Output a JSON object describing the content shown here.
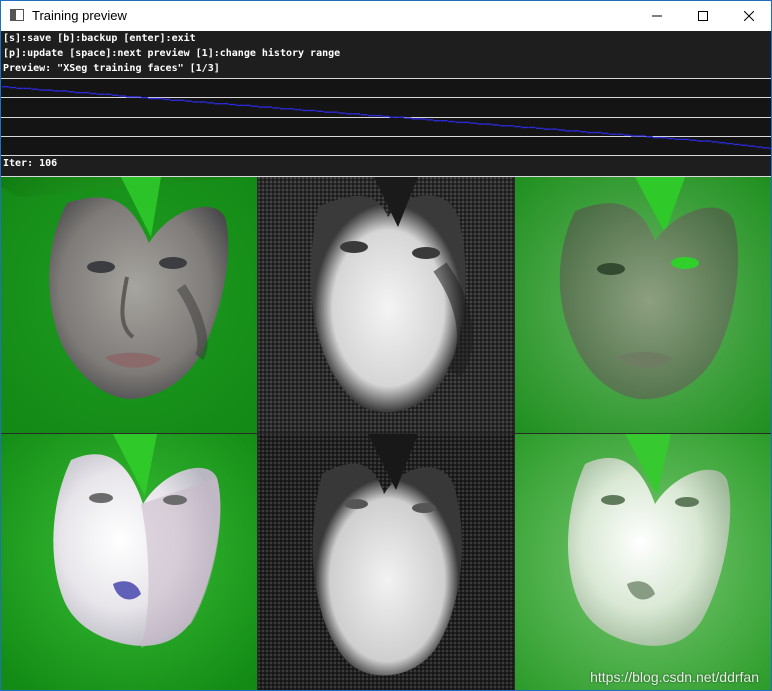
{
  "window": {
    "title": "Training preview",
    "app_icon": "window-app-icon",
    "controls": {
      "minimize_icon": "minimize-icon",
      "maximize_icon": "maximize-icon",
      "close_icon": "close-icon"
    }
  },
  "help": {
    "line1": "[s]:save [b]:backup [enter]:exit",
    "line2": "[p]:update [space]:next preview [1]:change history range",
    "line3": "Preview: \"XSeg training faces\" [1/3]"
  },
  "loss_history": {
    "color": "#2a2ad8",
    "values": [
      0.92,
      0.91,
      0.9,
      0.9,
      0.89,
      0.88,
      0.88,
      0.87,
      0.87,
      0.86,
      0.85,
      0.85,
      0.84,
      0.83,
      0.83,
      0.82,
      0.81,
      0.8,
      0.8,
      0.79,
      0.78,
      0.78,
      0.77,
      0.76,
      0.76,
      0.75,
      0.74,
      0.74,
      0.73,
      0.72,
      0.72,
      0.71,
      0.7,
      0.7,
      0.69,
      0.68,
      0.68,
      0.67,
      0.66,
      0.66,
      0.65,
      0.64,
      0.64,
      0.63,
      0.62,
      0.62,
      0.61,
      0.6,
      0.6,
      0.59,
      0.58,
      0.58,
      0.57,
      0.56,
      0.56,
      0.55,
      0.54,
      0.54,
      0.53,
      0.52,
      0.52,
      0.51,
      0.5,
      0.5,
      0.49,
      0.48,
      0.48,
      0.47,
      0.46,
      0.46,
      0.45,
      0.44,
      0.44,
      0.43,
      0.42,
      0.42,
      0.41,
      0.4,
      0.4,
      0.39,
      0.38,
      0.38,
      0.37,
      0.36,
      0.36,
      0.35,
      0.34,
      0.34,
      0.33,
      0.32,
      0.32,
      0.31,
      0.3,
      0.3,
      0.29,
      0.28,
      0.28,
      0.27,
      0.26,
      0.25,
      0.24,
      0.23,
      0.22,
      0.21,
      0.2,
      0.19
    ]
  },
  "status": {
    "iter": "Iter: 106"
  },
  "preview": {
    "tiles": [
      "training-face-masked-tile",
      "predicted-mask-tile",
      "predicted-overlay-tile",
      "training-face-warped-masked-tile",
      "predicted-mask-warped-tile",
      "predicted-overlay-warped-tile"
    ]
  },
  "watermark": {
    "text": "https://blog.csdn.net/ddrfan"
  }
}
